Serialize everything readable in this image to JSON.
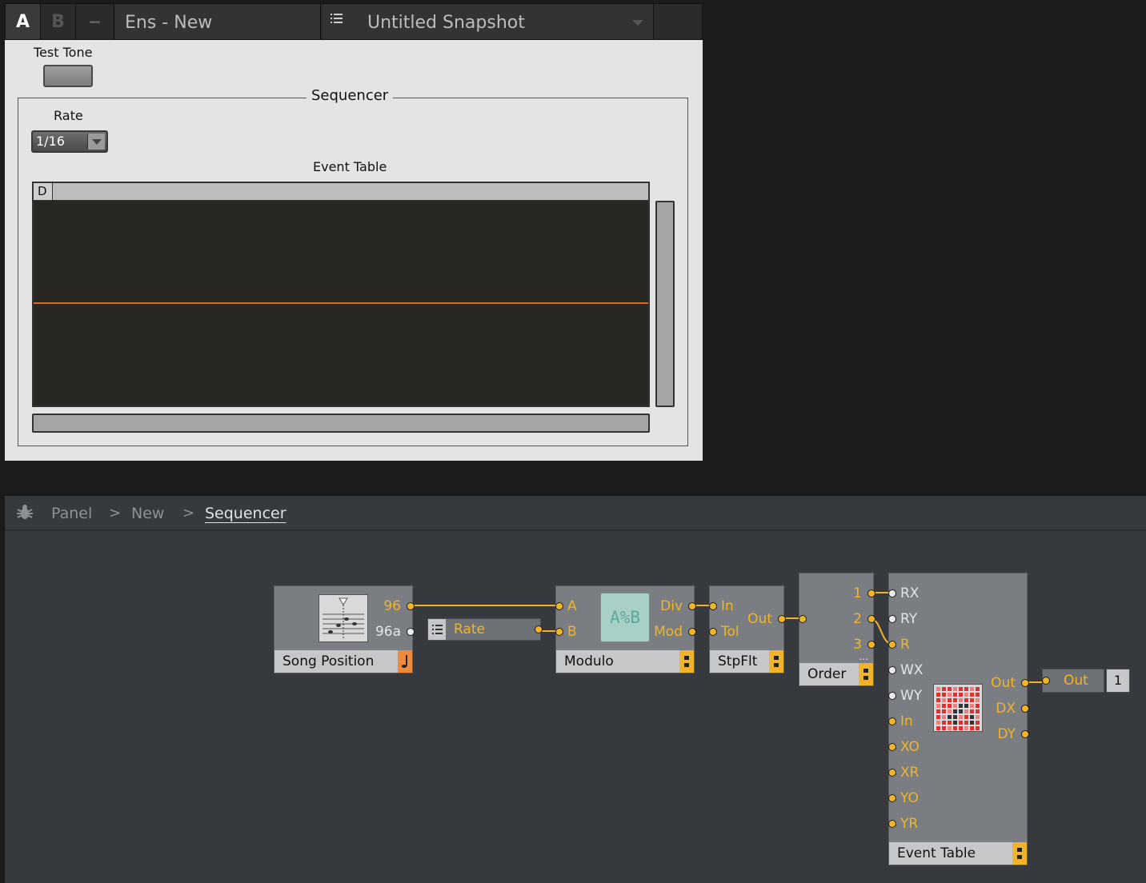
{
  "toolbar": {
    "snapshot_a": "A",
    "snapshot_b": "B",
    "minus": "−",
    "ensemble_name": "Ens - New",
    "snapshot_name": "Untitled Snapshot",
    "list_icon": "list-icon",
    "chevron_icon": "chevron-down-icon"
  },
  "panel": {
    "test_tone_label": "Test Tone",
    "sequencer_title": "Sequencer",
    "rate_label": "Rate",
    "rate_value": "1/16",
    "event_table_label": "Event Table",
    "event_table_column": "D",
    "line_color": "#e8651a"
  },
  "structure": {
    "breadcrumb": [
      "Panel",
      "New",
      "Sequencer"
    ],
    "bug_icon": "bug-icon",
    "modules": {
      "song_position": {
        "label": "Song Position",
        "out_96": "96",
        "out_96a": "96a"
      },
      "rate": {
        "label": "Rate"
      },
      "modulo": {
        "label": "Modulo",
        "display": "A%B",
        "in_a": "A",
        "in_b": "B",
        "out_div": "Div",
        "out_mod": "Mod"
      },
      "stpflt": {
        "label": "StpFlt",
        "in_in": "In",
        "in_tol": "Tol",
        "out": "Out"
      },
      "order": {
        "label": "Order",
        "out_1": "1",
        "out_2": "2",
        "out_3": "3",
        "more": "..."
      },
      "event_table": {
        "label": "Event Table",
        "inputs": [
          "RX",
          "RY",
          "R",
          "WX",
          "WY",
          "In",
          "XO",
          "XR",
          "YO",
          "YR"
        ],
        "outputs": [
          "Out",
          "DX",
          "DY"
        ]
      },
      "out": {
        "label": "Out",
        "channel": "1"
      }
    },
    "accent_color": "#f0b42a"
  }
}
